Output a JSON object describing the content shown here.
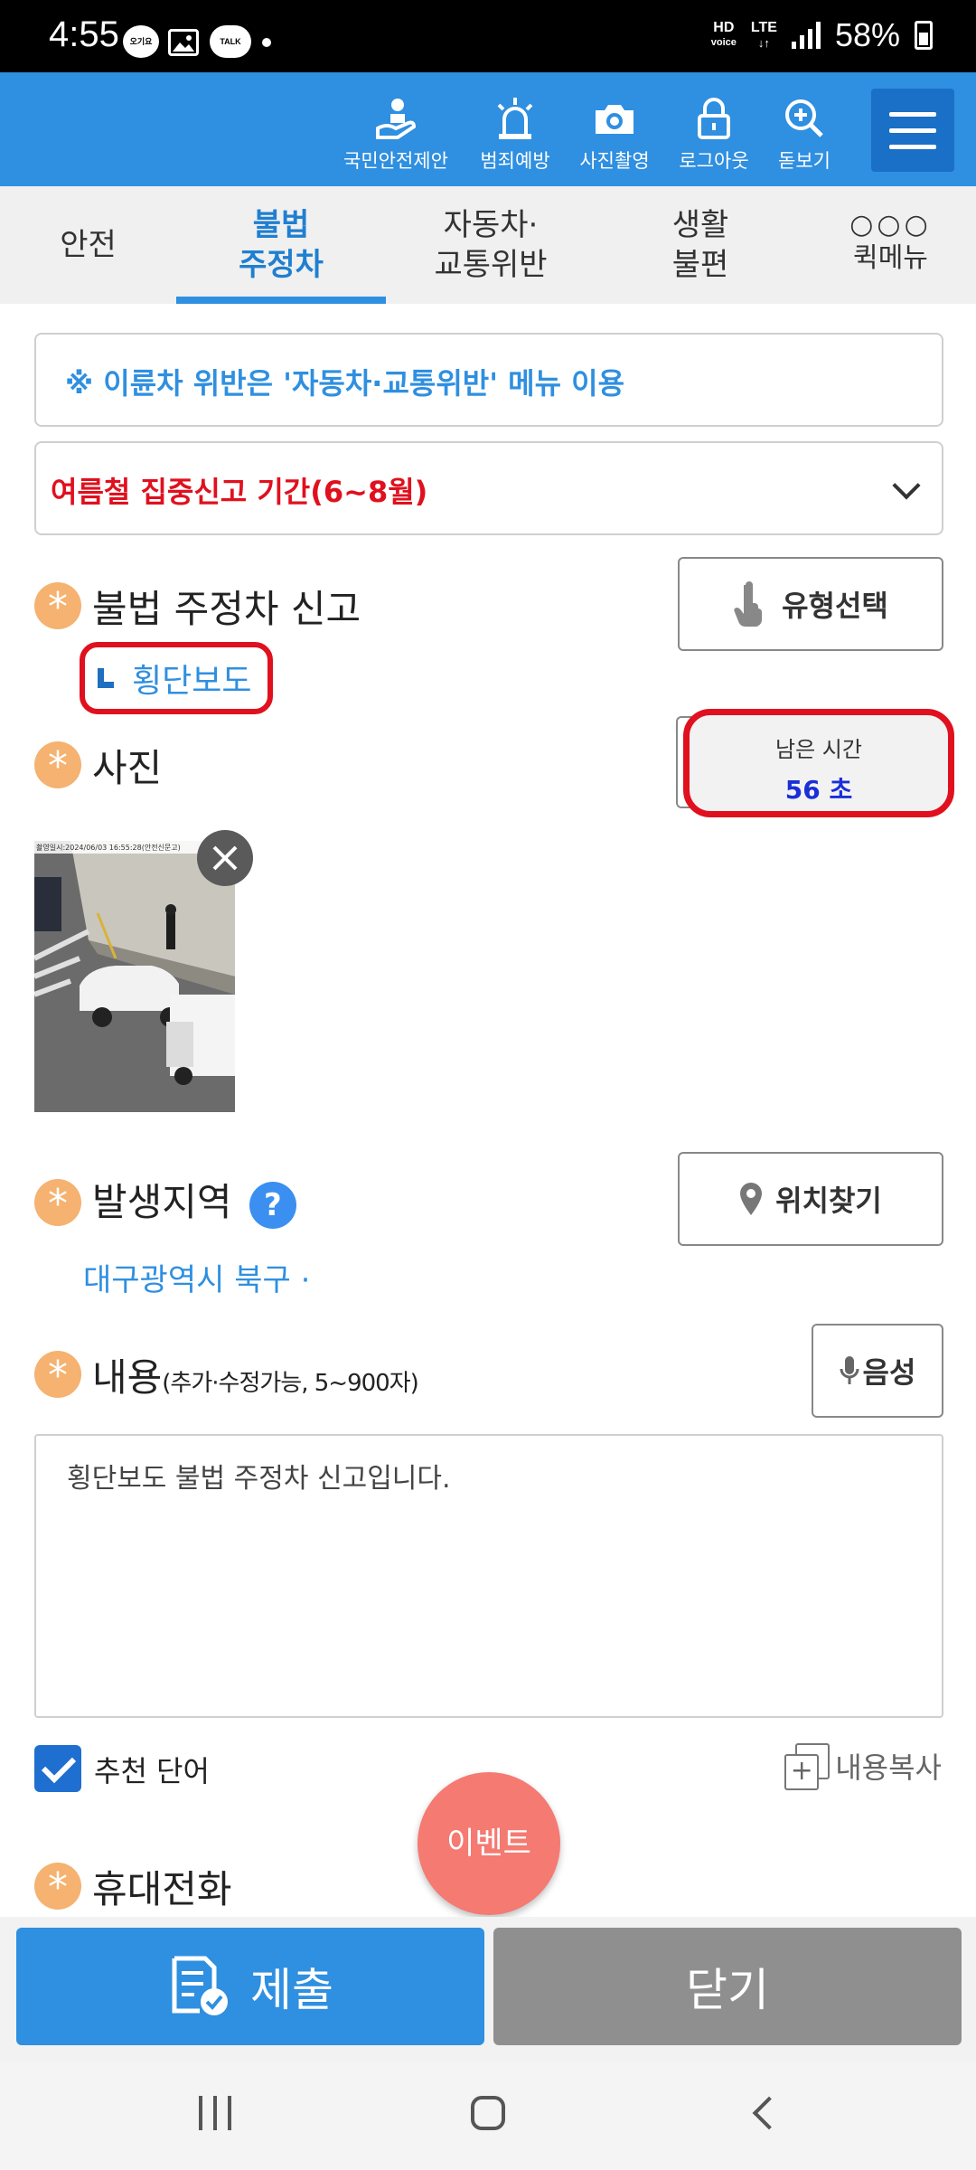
{
  "status_bar": {
    "time": "4:55",
    "notif_icons": [
      "오기요",
      "gallery-icon",
      "TALK"
    ],
    "hd": "HD",
    "voice": "voice",
    "network": "LTE",
    "battery": "58%"
  },
  "header": {
    "tools": [
      {
        "label": "국민안전제안",
        "icon": "hand-person-icon"
      },
      {
        "label": "범죄예방",
        "icon": "siren-icon"
      },
      {
        "label": "사진촬영",
        "icon": "camera-icon"
      },
      {
        "label": "로그아웃",
        "icon": "lock-icon"
      },
      {
        "label": "돋보기",
        "icon": "magnifier-icon"
      }
    ],
    "menu_icon": "hamburger-icon"
  },
  "tabs": [
    {
      "line1": "안전",
      "line2": ""
    },
    {
      "line1": "불법",
      "line2": "주정차",
      "active": true
    },
    {
      "line1": "자동차·",
      "line2": "교통위반"
    },
    {
      "line1": "생활",
      "line2": "불편"
    },
    {
      "line1": "●●●",
      "line2": "퀵메뉴"
    }
  ],
  "notice": "※ 이륜차 위반은 '자동차·교통위반' 메뉴 이용",
  "summer_period": "여름철 집중신고 기간(6~8월)",
  "report": {
    "label": "불법 주정차 신고",
    "type_button": "유형선택",
    "selected_type": "횡단보도"
  },
  "photo": {
    "label": "사진",
    "timer_label": "남은 시간",
    "timer_value": "56 초",
    "stamp": "촬영일시:2024/06/03 16:55:28(안전신문고)"
  },
  "location": {
    "label": "발생지역",
    "help": "?",
    "find_button": "위치찾기",
    "address": "대구광역시 북구 ·"
  },
  "content": {
    "label": "내용",
    "hint": "(추가·수정가능, 5~900자)",
    "voice_button": "음성",
    "text": "횡단보도 불법 주정차 신고입니다."
  },
  "recommend_label": "추천 단어",
  "copy_label": "내용복사",
  "event_label": "이벤트",
  "phone_label": "휴대전화",
  "submit_label": "제출",
  "close_label": "닫기",
  "colors": {
    "primary": "#2f8fe0",
    "alert_red": "#e0101e",
    "star_orange": "#f5b270",
    "event_pink": "#f47a72",
    "close_gray": "#8f8f8f"
  }
}
